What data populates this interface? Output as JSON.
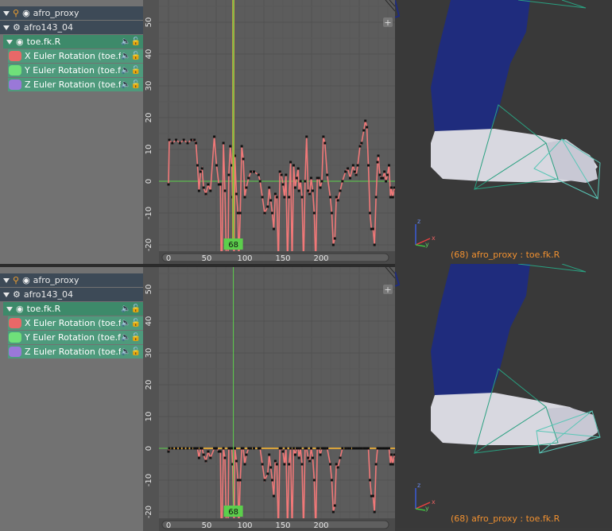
{
  "panels": [
    {
      "channels": {
        "object": "afro_proxy",
        "action": "afro143_04",
        "group": "toe.fk.R",
        "fcurves": [
          {
            "label": "X Euler Rotation (toe.fk.R)",
            "color": "#e86868"
          },
          {
            "label": "Y Euler Rotation (toe.fk.R)",
            "color": "#6fe07a"
          },
          {
            "label": "Z Euler Rotation (toe.fk.R)",
            "color": "#9a78d8"
          }
        ]
      },
      "graph": {
        "current_frame": "68",
        "x_ticks": [
          "0",
          "50",
          "100",
          "150",
          "200"
        ],
        "y_ticks": [
          "50",
          "40",
          "30",
          "20",
          "10",
          "0",
          "-10",
          "-20"
        ],
        "x_curve": [
          [
            0,
            -1
          ],
          [
            1,
            13
          ],
          [
            5,
            12
          ],
          [
            10,
            13
          ],
          [
            15,
            12
          ],
          [
            20,
            13
          ],
          [
            25,
            12
          ],
          [
            30,
            13
          ],
          [
            34,
            13
          ],
          [
            36,
            12
          ],
          [
            38,
            5
          ],
          [
            40,
            -3
          ],
          [
            42,
            3
          ],
          [
            44,
            4
          ],
          [
            46,
            -2
          ],
          [
            49,
            -4
          ],
          [
            52,
            -1
          ],
          [
            55,
            -3
          ],
          [
            60,
            14
          ],
          [
            63,
            5
          ],
          [
            66,
            -1
          ],
          [
            68,
            -1
          ],
          [
            69,
            -25
          ],
          [
            70,
            -27
          ],
          [
            72,
            12
          ],
          [
            74,
            -3
          ],
          [
            76,
            -27
          ],
          [
            78,
            -27
          ],
          [
            79,
            2
          ],
          [
            81,
            11
          ],
          [
            83,
            5
          ],
          [
            84,
            -5
          ],
          [
            86,
            -27
          ],
          [
            87,
            8
          ],
          [
            89,
            -4
          ],
          [
            91,
            -10
          ],
          [
            92,
            -27
          ],
          [
            94,
            -10
          ],
          [
            96,
            11
          ],
          [
            98,
            7
          ],
          [
            100,
            -5
          ],
          [
            102,
            -2
          ],
          [
            105,
            1
          ],
          [
            108,
            3
          ],
          [
            112,
            3
          ],
          [
            118,
            2
          ],
          [
            120,
            0
          ],
          [
            123,
            -5
          ],
          [
            126,
            -10
          ],
          [
            130,
            -8
          ],
          [
            132,
            -2
          ],
          [
            134,
            -6
          ],
          [
            136,
            -10
          ],
          [
            138,
            -15
          ],
          [
            140,
            -4
          ],
          [
            142,
            -5
          ],
          [
            144,
            -27
          ],
          [
            146,
            3
          ],
          [
            148,
            2
          ],
          [
            150,
            -1
          ],
          [
            152,
            -5
          ],
          [
            154,
            2
          ],
          [
            156,
            -27
          ],
          [
            158,
            -5
          ],
          [
            160,
            6
          ],
          [
            162,
            -27
          ],
          [
            164,
            5
          ],
          [
            166,
            -2
          ],
          [
            168,
            1
          ],
          [
            170,
            4
          ],
          [
            171,
            -3
          ],
          [
            173,
            0
          ],
          [
            175,
            -5
          ],
          [
            177,
            -27
          ],
          [
            179,
            0
          ],
          [
            181,
            14
          ],
          [
            183,
            -3
          ],
          [
            185,
            -4
          ],
          [
            187,
            1
          ],
          [
            189,
            -3
          ],
          [
            191,
            -10
          ],
          [
            193,
            -27
          ],
          [
            195,
            1
          ],
          [
            197,
            1
          ],
          [
            199,
            -2
          ],
          [
            201,
            0
          ],
          [
            203,
            14
          ],
          [
            205,
            12
          ],
          [
            208,
            2
          ],
          [
            212,
            -5
          ],
          [
            214,
            -10
          ],
          [
            216,
            -20
          ],
          [
            218,
            -18
          ],
          [
            220,
            -5
          ],
          [
            222,
            -6
          ],
          [
            225,
            -3
          ],
          [
            228,
            0
          ],
          [
            232,
            3
          ],
          [
            235,
            4
          ],
          [
            238,
            1
          ],
          [
            242,
            5
          ],
          [
            244,
            3
          ],
          [
            246,
            2
          ],
          [
            248,
            5
          ],
          [
            251,
            11
          ],
          [
            253,
            12
          ],
          [
            256,
            16
          ],
          [
            258,
            19
          ],
          [
            260,
            17
          ],
          [
            262,
            5
          ],
          [
            264,
            -10
          ],
          [
            266,
            -15
          ],
          [
            268,
            -15
          ],
          [
            270,
            -20
          ],
          [
            272,
            -5
          ],
          [
            274,
            6
          ],
          [
            275,
            8
          ],
          [
            277,
            2
          ],
          [
            279,
            1
          ],
          [
            281,
            1
          ],
          [
            283,
            3
          ],
          [
            285,
            0
          ],
          [
            287,
            2
          ],
          [
            289,
            5
          ],
          [
            291,
            -5
          ],
          [
            292,
            -2
          ],
          [
            294,
            -5
          ],
          [
            296,
            -2
          ],
          [
            298,
            -3
          ],
          [
            300,
            -2
          ],
          [
            302,
            -2
          ],
          [
            304,
            -4
          ],
          [
            305,
            -3
          ],
          [
            306,
            -2
          ],
          [
            307,
            -2
          ]
        ],
        "x_curve_range": [
          -25,
          195
        ],
        "show_y_z_flat": false
      },
      "viewport": {
        "label": "(68) afro_proxy : toe.fk.R"
      }
    },
    {
      "channels": {
        "object": "afro_proxy",
        "action": "afro143_04",
        "group": "toe.fk.R",
        "fcurves": [
          {
            "label": "X Euler Rotation (toe.fk.R)",
            "color": "#e86868"
          },
          {
            "label": "Y Euler Rotation (toe.fk.R)",
            "color": "#6fe07a"
          },
          {
            "label": "Z Euler Rotation (toe.fk.R)",
            "color": "#9a78d8"
          }
        ]
      },
      "graph": {
        "current_frame": "68",
        "x_ticks": [
          "0",
          "50",
          "100",
          "150",
          "200"
        ],
        "y_ticks": [
          "50",
          "40",
          "30",
          "20",
          "10",
          "0",
          "-10",
          "-20"
        ],
        "show_y_z_flat": true
      },
      "viewport": {
        "label": "(68) afro_proxy : toe.fk.R"
      }
    }
  ],
  "colors": {
    "graph_bg": "#5c5c5c",
    "grid": "#555555",
    "x_curve": "#f07878",
    "flat_curve": "#d8a23a",
    "frame_line": "#5ccf4c",
    "zero_line": "#5ccf4c",
    "leg": "#1f2c7d",
    "foot": "#d8d8e0",
    "bone": "#59c6b6",
    "viewport_text": "#f09030"
  }
}
